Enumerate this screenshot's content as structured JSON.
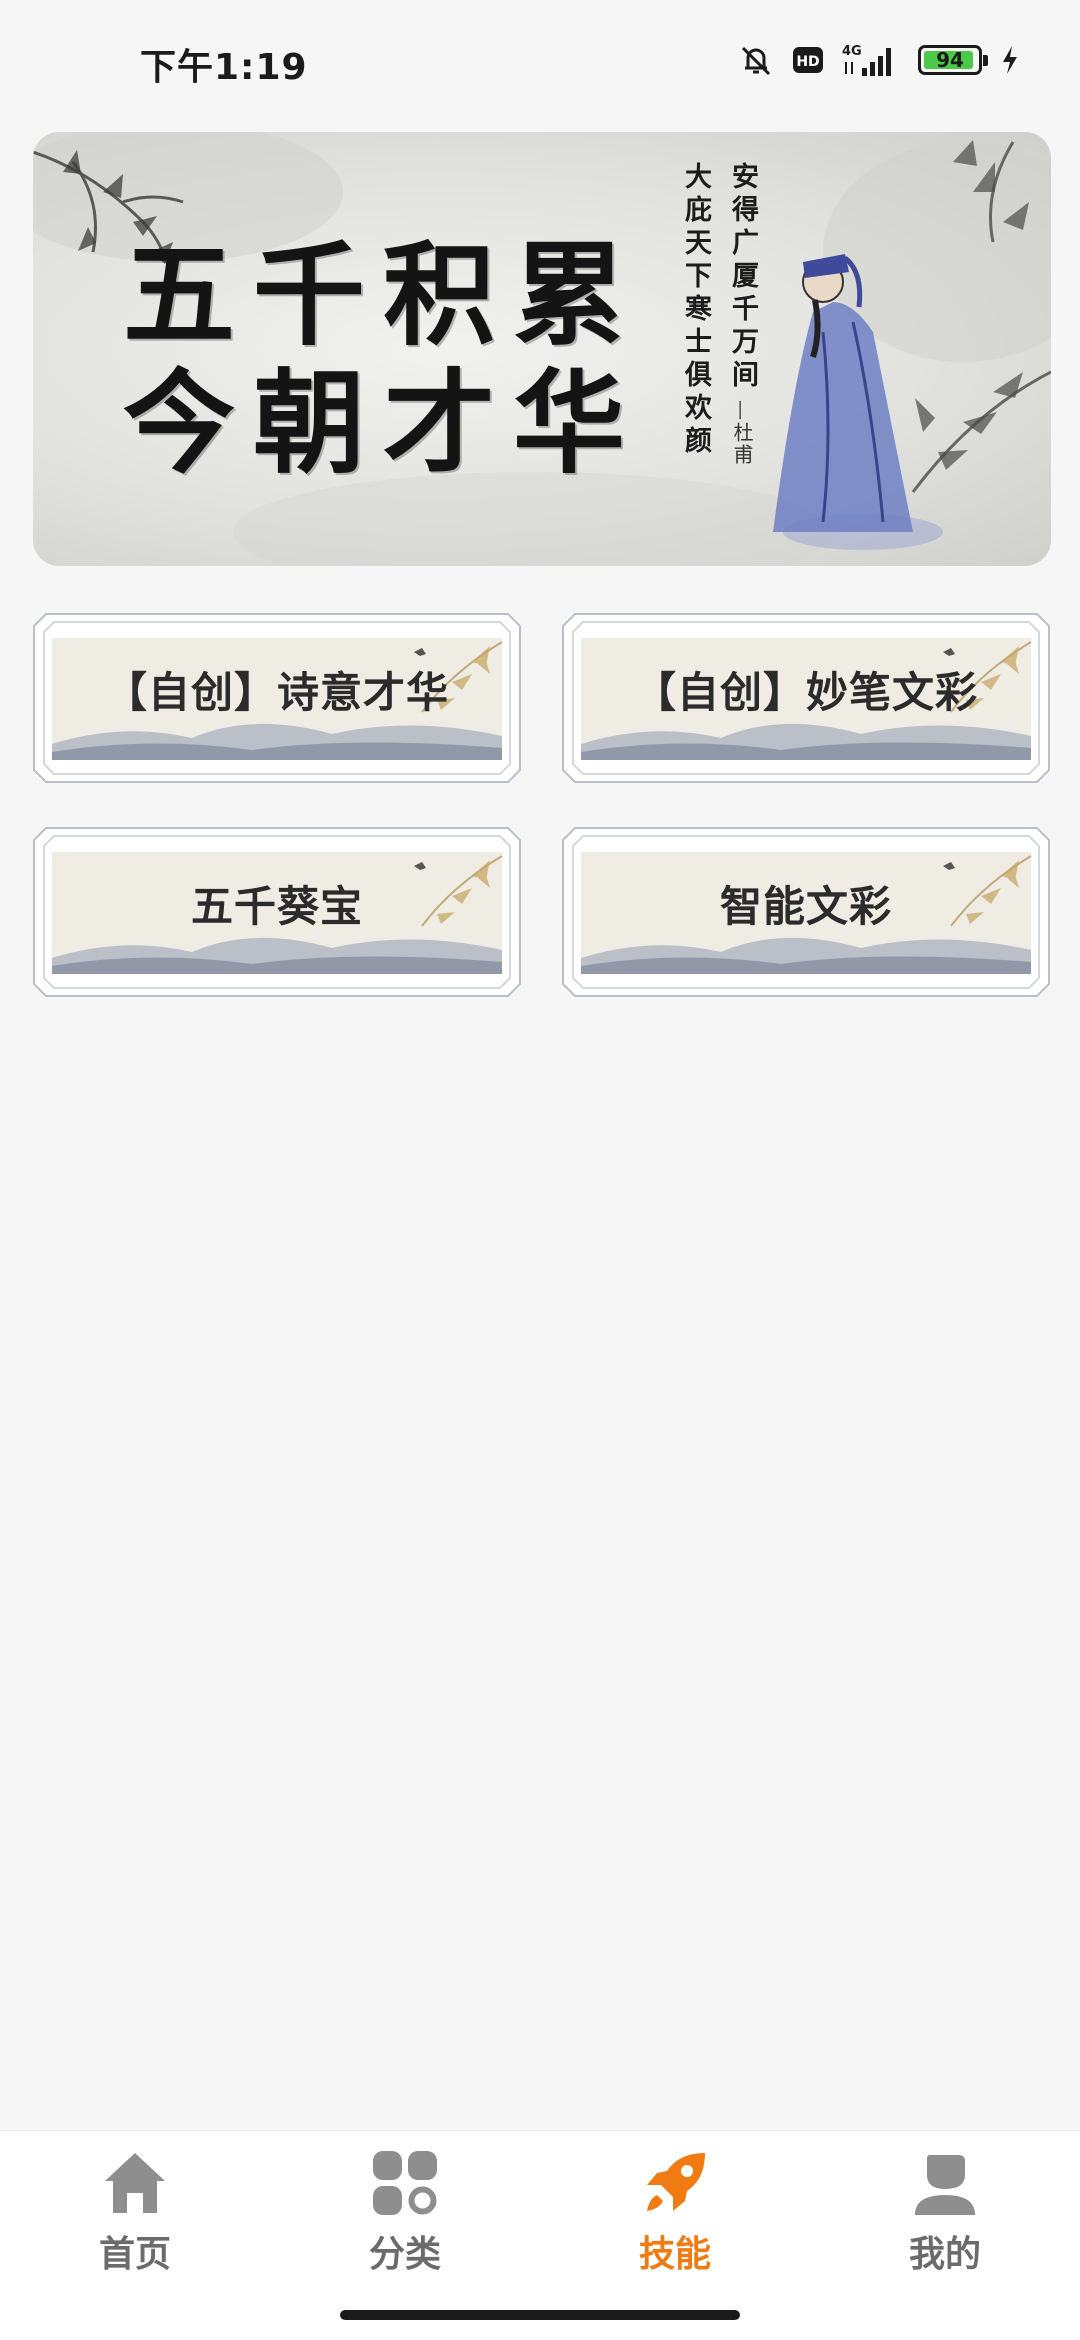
{
  "status_bar": {
    "time": "下午1:19",
    "network": "4G",
    "hd_label": "HD",
    "battery": "94",
    "battery_level": 0.94,
    "icons": [
      "mute-bell-icon",
      "hd-icon",
      "4g-signal-icon",
      "battery-icon",
      "charging-icon"
    ]
  },
  "banner": {
    "title_line1": "五千积累",
    "title_line2": "今朝才华",
    "poem_line1": "安得广厦千万间",
    "poem_line2": "大庇天下寒士俱欢颜",
    "poem_author": "—杜甫"
  },
  "skills": [
    {
      "label": "【自创】诗意才华"
    },
    {
      "label": "【自创】妙笔文彩"
    },
    {
      "label": "五千葵宝"
    },
    {
      "label": "智能文彩"
    }
  ],
  "nav": {
    "items": [
      {
        "label": "首页",
        "icon": "home-icon"
      },
      {
        "label": "分类",
        "icon": "category-grid-icon"
      },
      {
        "label": "技能",
        "icon": "rocket-icon"
      },
      {
        "label": "我的",
        "icon": "user-icon"
      }
    ],
    "active_index": 2,
    "active_color": "#f07b12",
    "inactive_color": "#8e8e8e"
  }
}
